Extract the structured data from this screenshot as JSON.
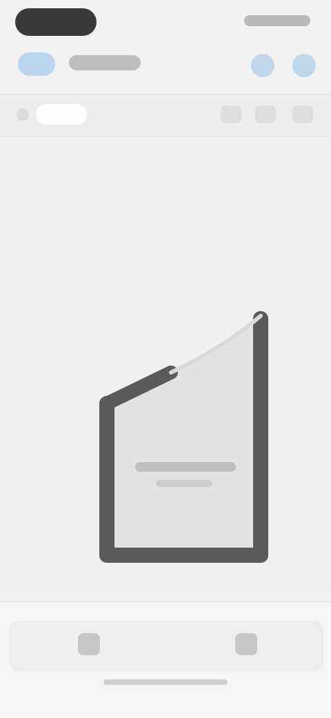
{
  "status_bar": {
    "time": "",
    "icons": [
      "signal-icon",
      "wifi-icon",
      "battery-icon"
    ]
  },
  "header": {
    "back_label": "",
    "title": "",
    "actions": [
      "undo-icon",
      "redo-icon"
    ]
  },
  "toolbar": {
    "selected_tool": "",
    "tools": [
      "pen-icon",
      "shape-icon",
      "more-icon"
    ]
  },
  "canvas": {
    "shape": "pentagon-outline",
    "caption": ""
  },
  "bottom_bar": {
    "icons": [
      "layers-icon",
      "export-icon"
    ]
  },
  "colors": {
    "background": "#f2f2f2",
    "shape_stroke": "#5a5a5a",
    "shape_fill": "#e2e2e2",
    "accent": "#bcd4ec"
  }
}
